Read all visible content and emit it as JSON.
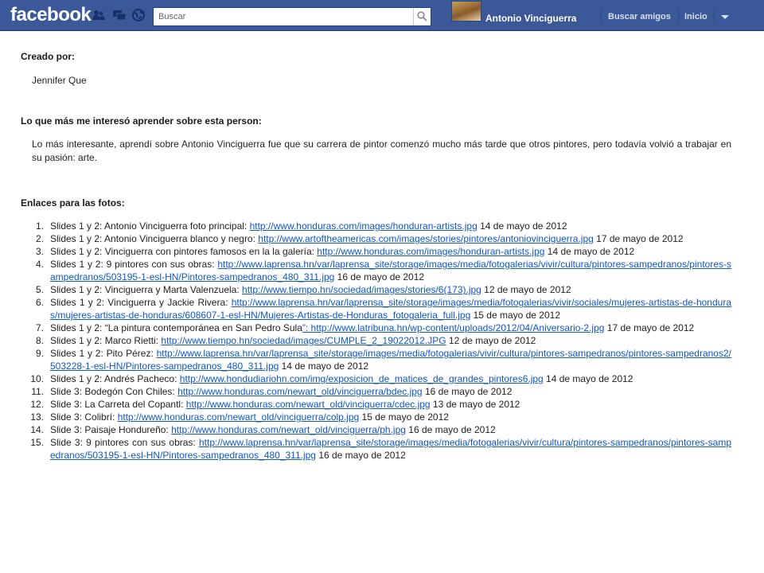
{
  "topbar": {
    "logo": "facebook",
    "search_placeholder": "Buscar",
    "username": "Antonio Vinciguerra",
    "nav": [
      "Buscar amigos",
      "Inicio"
    ]
  },
  "note": {
    "created_label": "Creado por:",
    "author": "Jennifer Que",
    "interest_label": "Lo que más me interesó aprender sobre esta person:",
    "interest_text": "Lo más interesante, aprendí sobre Antonio Vinciguerra fue que su carrera de pintor comenzó mucho más tarde que otros pintores, pero todavía volvió a trabajar en su pasión: arte.",
    "links_label": "Enlaces para las fotos:",
    "links": [
      {
        "n": "1.",
        "pre": "Slides 1 y 2: Antonio Vinciguerra foto principal: ",
        "url": "http://www.honduras.com/images/honduran-artists.jpg",
        "date": " 14 de mayo de 2012"
      },
      {
        "n": "2.",
        "pre": "Slides 1 y 2: Antonio Vinciguerra blanco y negro: ",
        "url": "http://www.artoftheamericas.com/images/stories/pintores/antoniovinciguerra.jpg",
        "date": " 17 de mayo de 2012"
      },
      {
        "n": "3.",
        "pre": "Slides 1 y 2: Vinciguerra con pintores famosos en la la galería: ",
        "url": "http://www.honduras.com/images/honduran-artists.jpg",
        "date": " 14 de mayo de 2012"
      },
      {
        "n": "4.",
        "pre": "Slides 1 y 2: 9 pintores con sus obras: ",
        "url": "http://www.laprensa.hn/var/laprensa_site/storage/images/media/fotogalerias/vivir/cultura/pintores-sampedranos/pintores-sampedranos/503195-1-esl-HN/Pintores-sampedranos_480_311.jpg",
        "date": "  16 de mayo de 2012"
      },
      {
        "n": "5.",
        "pre": "Slides 1 y 2: Vinciguerra y Marta Valenzuela: ",
        "url": "http://www.tiempo.hn/sociedad/images/stories/6(173).jpg",
        "date": " 12 de mayo de 2012"
      },
      {
        "n": "6.",
        "pre": "Slides 1 y 2: Vinciguerra y Jackie Rivera: ",
        "url": "http://www.laprensa.hn/var/laprensa_site/storage/images/media/fotogalerias/vivir/sociales/mujeres-artistas-de-honduras/mujeres-artistas-de-honduras/608607-1-esl-HN/Mujeres-Artistas-de-Honduras_fotogaleria_full.jpg",
        "date": " 15 de mayo de 2012"
      },
      {
        "n": "7.",
        "pre": "Slides 1 y 2: “La pintura contemporánea en San Pedro Sula",
        "url": "”: http://www.latribuna.hn/wp-content/uploads/2012/04/Aniversario-2.jpg",
        "date": " 17 de mayo de 2012"
      },
      {
        "n": "8.",
        "pre": "Slides 1 y 2: Marco Rietti: ",
        "url": "http://www.tiempo.hn/sociedad/images/CUMPLE_2_19022012.JPG",
        "date": "  12 de mayo de 2012"
      },
      {
        "n": "9.",
        "pre": "Slides 1 y 2: Pito Pérez: ",
        "url": "http://www.laprensa.hn/var/laprensa_site/storage/images/media/fotogalerias/vivir/cultura/pintores-sampedranos/pintores-sampedranos2/503228-1-esl-HN/Pintores-sampedranos_480_311.jpg",
        "date": "  14 de mayo de 2012"
      },
      {
        "n": "10.",
        "pre": "Slides 1 y 2: Andrés Pacheco: ",
        "url": "http://www.hondudiariohn.com/img/exposicion_de_matices_de_grandes_pintores6.jpg",
        "date": " 14 de mayo de 2012"
      },
      {
        "n": "11.",
        "pre": "Slide 3: Bodegón Con Chiles: ",
        "url": "http://www.honduras.com/newart_old/vinciguerra/bdec.jpg",
        "date": " 16 de mayo de 2012"
      },
      {
        "n": "12.",
        "pre": "Slide 3: La Carreta  del Copantl: ",
        "url": "http://www.honduras.com/newart_old/vinciguerra/cdec.jpg",
        "date": " 13 de mayo de 2012"
      },
      {
        "n": "13.",
        "pre": "Slide 3: Colibrí: ",
        "url": "http://www.honduras.com/newart_old/vinciguerra/colp.jpg",
        "date": " 15 de mayo de 2012"
      },
      {
        "n": "14.",
        "pre": "Slide 3: Paisaje Hondureño: ",
        "url": "http://www.honduras.com/newart_old/vinciguerra/ph.jpg",
        "date": " 16 de mayo de 2012"
      },
      {
        "n": "15.",
        "pre": "Slide 3: 9 pintores con sus obras: ",
        "url": "http://www.laprensa.hn/var/laprensa_site/storage/images/media/fotogalerias/vivir/cultura/pintores-sampedranos/pintores-sampedranos/503195-1-esl-HN/Pintores-sampedranos_480_311.jpg",
        "date": "  16 de mayo de 2012"
      }
    ]
  },
  "icons": [
    "friends-icon",
    "messages-icon",
    "globe-icon",
    "search-icon",
    "chevron-down-icon"
  ],
  "colors": {
    "brand": "#3b5998",
    "link": "#1155cc"
  }
}
